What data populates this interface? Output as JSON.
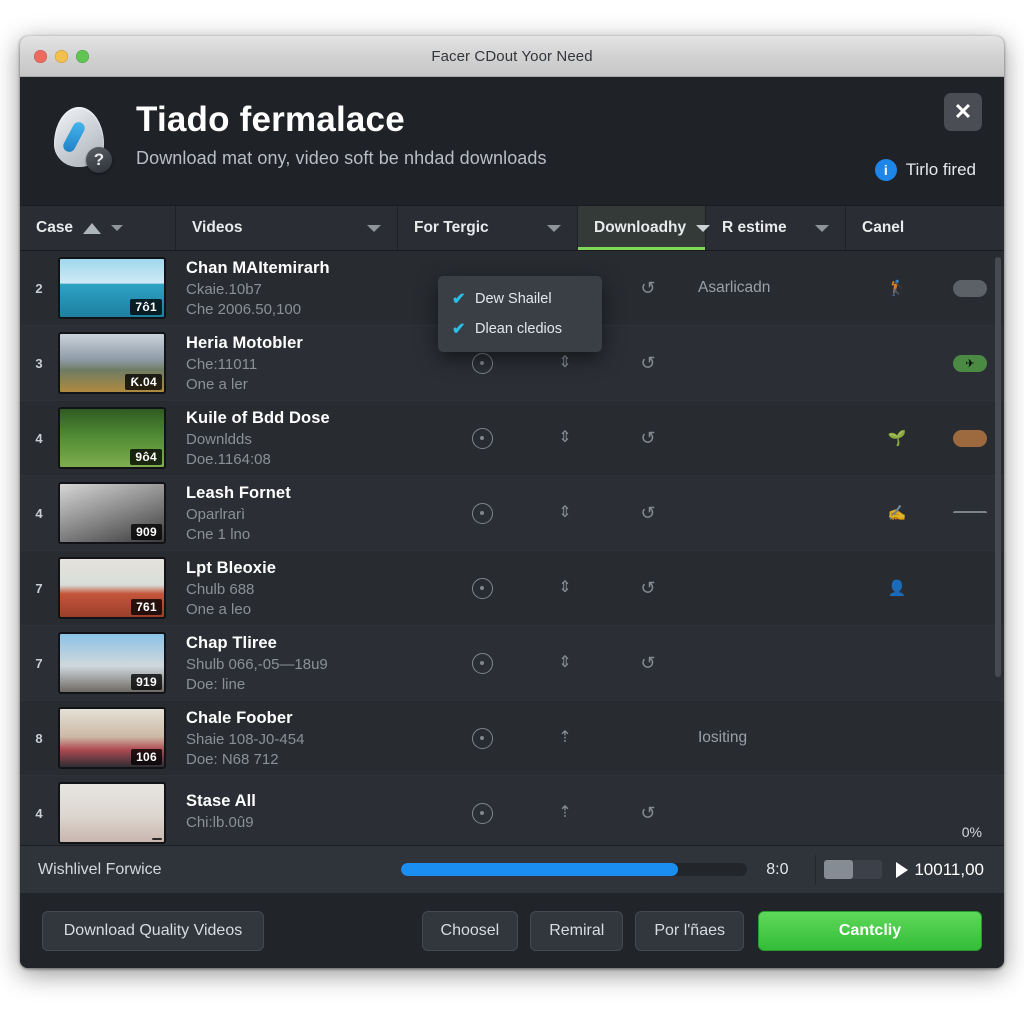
{
  "window": {
    "title": "Facer CDout Yoor Need",
    "traffic_lights": [
      "close",
      "minimize",
      "zoom"
    ]
  },
  "header": {
    "title": "Tiado fermalace",
    "subtitle": "Download mat ony, video soft be nhdad downloads",
    "note": "Tirlo fired",
    "note_icon": "info-icon",
    "close_label": "✕",
    "logo_q": "?"
  },
  "toolbar": {
    "columns": [
      {
        "label": "Case",
        "sort": "asc",
        "has_caret": true,
        "active": false
      },
      {
        "label": "Videos",
        "has_caret": true,
        "active": false
      },
      {
        "label": "For Tergic",
        "has_caret": true,
        "active": false
      },
      {
        "label": "Downloadhy",
        "has_caret": true,
        "active": true
      },
      {
        "label": "R estime",
        "has_caret": true,
        "active": false
      },
      {
        "label": "Canel",
        "has_caret": false,
        "active": false
      }
    ],
    "accent_color": "#7ed957"
  },
  "dropdown": {
    "open": true,
    "items": [
      {
        "label": "Dew Shailel",
        "checked": true
      },
      {
        "label": "Dlean cledios",
        "checked": true
      }
    ],
    "check_color": "#29c0e8"
  },
  "list": {
    "rows": [
      {
        "num": "2",
        "badge": "7ô1",
        "thumb": "seagull-ocean",
        "title": "Chan MAItemirarh",
        "line2": "Ckaie.10b7",
        "line3": "Che 2006.50,100",
        "col_text": "Asarlicadn",
        "emoji": "🏌️",
        "tail": "pill-grey"
      },
      {
        "num": "3",
        "badge": "Ƙ.04",
        "thumb": "mountains",
        "title": "Heria Motobler",
        "line2": "Che:11011",
        "line3": "One a ler",
        "col_text": "",
        "emoji": "",
        "tail": "pill-green"
      },
      {
        "num": "4",
        "badge": "9ô4",
        "thumb": "forest-path",
        "title": "Kuile of Bdd Dose",
        "line2": "Downldds",
        "line3": "Doe.1164:08",
        "col_text": "",
        "emoji": "🌱",
        "tail": "pill-brown"
      },
      {
        "num": "4",
        "badge": "909",
        "thumb": "portrait-bw",
        "title": "Leash Fornet",
        "line2": "Oparlrarì",
        "line3": "Cne 1 lno",
        "col_text": "",
        "emoji": "✍️",
        "tail": "pill-line"
      },
      {
        "num": "7",
        "badge": "761",
        "thumb": "man-orange",
        "title": "Lpt Bleoxie",
        "line2": "Chulb 688",
        "line3": "One a leo",
        "col_text": "",
        "emoji": "👤",
        "tail": ""
      },
      {
        "num": "7",
        "badge": "919",
        "thumb": "city-man",
        "title": "Chap Tliree",
        "line2": "Shulb 066,-05—18u9",
        "line3": "Doe: line",
        "col_text": "",
        "emoji": "",
        "tail": ""
      },
      {
        "num": "8",
        "badge": "106",
        "thumb": "dinner-table",
        "title": "Chale Foober",
        "line2": "Shaie 108-J0-454",
        "line3": "Doe: N68 712",
        "col_text": "Iositing",
        "emoji": "",
        "tail": ""
      },
      {
        "num": "4",
        "badge": "",
        "thumb": "woman-pink",
        "title": "Stase All",
        "line2": "Chi:lb.0û9",
        "line3": "",
        "col_text": "",
        "emoji": "",
        "tail": ""
      }
    ]
  },
  "status": {
    "label": "Wishlivel Forwice",
    "progress_percent": 80,
    "value": "8:0",
    "float_percent": "0%",
    "right_value": "10011,00",
    "progress_color": "#1b8ef2"
  },
  "footer": {
    "buttons": [
      {
        "label": "Download Quality Videos",
        "style": "wide"
      },
      {
        "label": "Choosel",
        "style": "normal"
      },
      {
        "label": "Remiral",
        "style": "normal"
      },
      {
        "label": "Por l'ñaes",
        "style": "normal"
      },
      {
        "label": "Cantcliy",
        "style": "primary"
      }
    ],
    "primary_color": "#33bd38"
  }
}
